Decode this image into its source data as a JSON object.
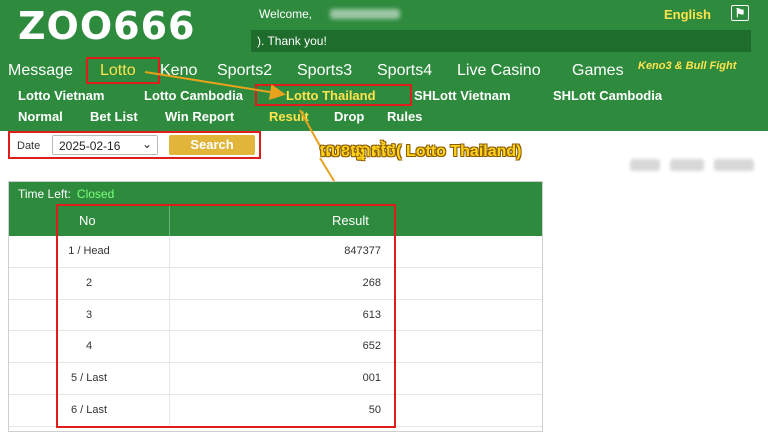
{
  "header": {
    "logo": "ZOO666",
    "welcome": "Welcome,",
    "notice": "). Thank you!",
    "language": "English",
    "flag_icon": "flag-icon"
  },
  "nav_main": [
    "Message",
    "Lotto",
    "Keno",
    "Sports2",
    "Sports3",
    "Sports4",
    "Live Casino",
    "Games"
  ],
  "nav_main_note": "Keno3 & Bull Fight",
  "nav_lotto": [
    "Lotto Vietnam",
    "Lotto Cambodia",
    "Lotto Thailand",
    "SHLott Vietnam",
    "SHLott Cambodia"
  ],
  "nav_sub": [
    "Normal",
    "Bet List",
    "Win Report",
    "Result",
    "Drop",
    "Rules"
  ],
  "search": {
    "date_label": "Date",
    "date_value": "2025-02-16",
    "button": "Search"
  },
  "annotation": "លេខឆ្នោតថៃ( Lotto Thailand)",
  "results": {
    "time_left_label": "Time Left:",
    "time_left_value": "Closed",
    "headers": {
      "no": "No",
      "result": "Result"
    },
    "rows": [
      {
        "no": "1 / Head",
        "result": "847377"
      },
      {
        "no": "2",
        "result": "268"
      },
      {
        "no": "3",
        "result": "613"
      },
      {
        "no": "4",
        "result": "652"
      },
      {
        "no": "5 / Last",
        "result": "001"
      },
      {
        "no": "6 / Last",
        "result": "50"
      }
    ]
  },
  "colors": {
    "header_green": "#2e8b3e",
    "accent_yellow": "#ffe34d",
    "annotation_red": "#e01d1d",
    "button_gold": "#e0b53a"
  }
}
